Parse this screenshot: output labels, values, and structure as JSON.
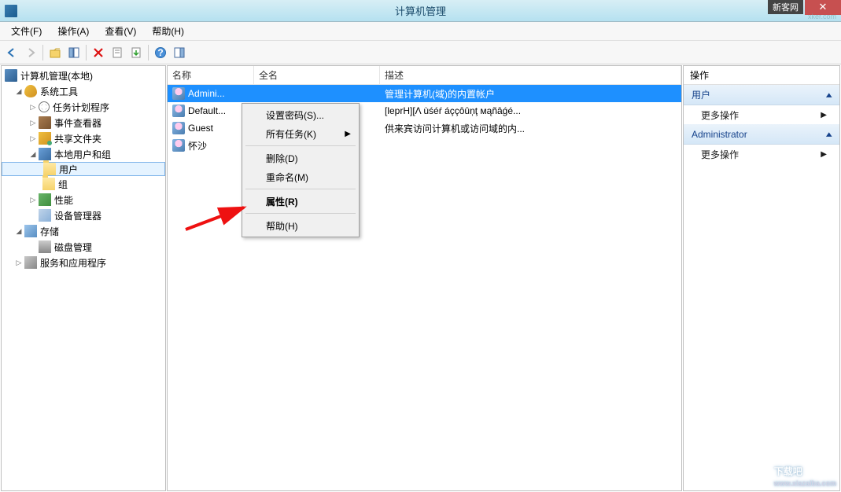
{
  "title": "计算机管理",
  "badge": "新客网",
  "watermark_small": "xker.com",
  "menubar": [
    "文件(F)",
    "操作(A)",
    "查看(V)",
    "帮助(H)"
  ],
  "tree": {
    "root": "计算机管理(本地)",
    "sys_tools": "系统工具",
    "task_sched": "任务计划程序",
    "event_viewer": "事件查看器",
    "shared": "共享文件夹",
    "local_users": "本地用户和组",
    "users_folder": "用户",
    "groups_folder": "组",
    "perf": "性能",
    "dev_mgr": "设备管理器",
    "storage": "存储",
    "disk_mgmt": "磁盘管理",
    "services_apps": "服务和应用程序"
  },
  "list": {
    "col_name": "名称",
    "col_full": "全名",
    "col_desc": "描述",
    "rows": [
      {
        "name": "Admini...",
        "full": "",
        "desc": "管理计算机(域)的内置帐户"
      },
      {
        "name": "Default...",
        "full": "",
        "desc": "[leprH][Λ ùśéŕ áççôûņţ мąñâǵé..."
      },
      {
        "name": "Guest",
        "full": "",
        "desc": "供来宾访问计算机或访问域的内..."
      },
      {
        "name": "怀沙",
        "full": "",
        "desc": ""
      }
    ]
  },
  "ctx": {
    "set_pw": "设置密码(S)...",
    "all_tasks": "所有任务(K)",
    "delete": "删除(D)",
    "rename": "重命名(M)",
    "properties": "属性(R)",
    "help": "帮助(H)"
  },
  "actions": {
    "pane_title": "操作",
    "section1": "用户",
    "more_ops": "更多操作",
    "section2": "Administrator"
  },
  "corner_wm": "下载吧",
  "corner_wm_sub": "www.xiazaiba.com"
}
